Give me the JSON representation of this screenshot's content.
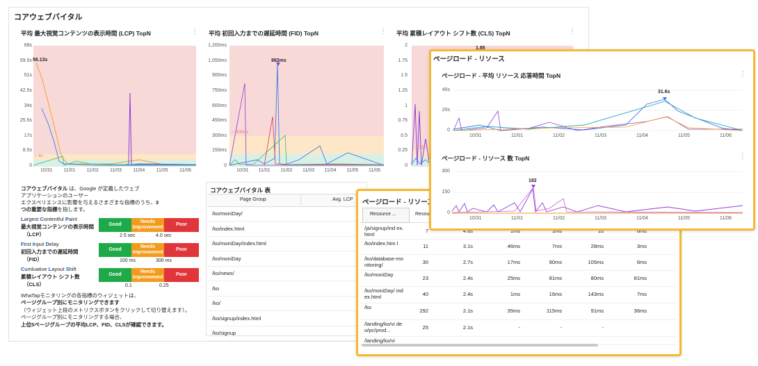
{
  "main": {
    "title": "コアウェブバイタル",
    "lcp": {
      "title": "平均 最大視覚コンテンツの表示時間 (LCP) TopN",
      "y_ticks": [
        "68s",
        "59.5s",
        "51s",
        "42.5s",
        "34s",
        "25.5s",
        "17s",
        "8.5s",
        "0"
      ],
      "x_ticks": [
        "10/31",
        "11/01",
        "11/02",
        "11/03",
        "11/04",
        "11/05",
        "11/06"
      ],
      "peak_label": "56.13s",
      "threshold_label": "~ 4s"
    },
    "fid": {
      "title": "平均 初回入力までの遅延時間 (FID) TopN",
      "y_ticks": [
        "1,200ms",
        "1,050ms",
        "900ms",
        "750ms",
        "600ms",
        "450ms",
        "300ms",
        "150ms",
        "0"
      ],
      "x_ticks": [
        "10/31",
        "11/01",
        "11/02",
        "11/03",
        "11/04",
        "11/05",
        "11/06"
      ],
      "peak_label": "982ms",
      "threshold_label": "~ 300ms"
    },
    "cls": {
      "title": "平均 累積レイアウト シフト数 (CLS) TopN",
      "y_ticks": [
        "2",
        "1.75",
        "1.5",
        "1.25",
        "1",
        "0.75",
        "0.5",
        "0.25",
        "0"
      ],
      "peak_label": "1.85",
      "threshold_label": "0.25"
    },
    "description": {
      "line1_bold": "コアウェブバイタル",
      "line1_rest": " は、Google が定義したウェブ",
      "line2": "アプリケーションのユーザー",
      "line3_a": "エクスペリエンスに影響を与えるさまざまな指標のうち、",
      "line3_b": "3",
      "line4": "つの重要な指標",
      "line4_rest": "を指します。"
    },
    "metrics": [
      {
        "en_first": "L",
        "en_rest1": "argest ",
        "en_c": "C",
        "en_rest2": "ontentful ",
        "en_p": "P",
        "en_rest3": "aint",
        "jp": "最大視覚コンテンツの表示時間",
        "abbr": "（LCP）",
        "good": "Good",
        "ni": "Needs Improvement",
        "poor": "Poor",
        "t1": "2.5 sec",
        "t2": "4.0 sec"
      },
      {
        "en_first": "F",
        "en_rest1": "irst ",
        "en_c": "I",
        "en_rest2": "nput ",
        "en_p": "D",
        "en_rest3": "elay",
        "jp": "初回入力までの遅延時間",
        "abbr": "（FID）",
        "good": "Good",
        "ni": "Needs Improvement",
        "poor": "Poor",
        "t1": "100 ms",
        "t2": "300 ms"
      },
      {
        "en_first": "C",
        "en_rest1": "umluative ",
        "en_c": "L",
        "en_rest2": "ayout ",
        "en_p": "S",
        "en_rest3": "hift",
        "jp": "累積レイアウト シフト数",
        "abbr": "（CLS）",
        "good": "Good",
        "ni": "Needs Improvement",
        "poor": "Poor",
        "t1": "0.1",
        "t2": "0.25"
      }
    ],
    "footnote": {
      "l1": "WhaTapモニタリングの各指標のウィジェットは、",
      "l2": "ページグループ別にモニタリングできます",
      "l3": "（ウィジェット上段のメトリクスボタンをクリックして切り替えます）。",
      "l4": "ページグループ別にモニタリングする場合、",
      "l5": "上位5ページグループの平均LCP、FID、CLSが確認できます。"
    },
    "table": {
      "title": "コアウェブバイタル 表",
      "headers": [
        "Page Group",
        "Avg. LCP"
      ],
      "rows": [
        "/ko/moniDay/",
        "/ko/index.html",
        "/ko/moniDay/index.html",
        "/ko/moniDay",
        "/ko/news/",
        "/ko",
        "/ko/",
        "/ko/signup/index.html",
        "/ko/signup"
      ]
    }
  },
  "resources_table": {
    "title": "ページロード - リソース",
    "headers": [
      "Resource ...",
      "Resou"
    ],
    "rows": [
      {
        "name": "/ja/signup/ind ex.html",
        "count": "7",
        "avg": "4.6s",
        "c3": "1ms",
        "c4": "1ms",
        "c5": "2s",
        "c6": "6ms"
      },
      {
        "name": "/ko/index.htm l",
        "count": "11",
        "avg": "3.1s",
        "c3": "46ms",
        "c4": "7ms",
        "c5": "28ms",
        "c6": "3ms"
      },
      {
        "name": "/ko/database-monitoring/",
        "count": "30",
        "avg": "2.7s",
        "c3": "17ms",
        "c4": "90ms",
        "c5": "105ms",
        "c6": "6ms"
      },
      {
        "name": "/ko/moniDay",
        "count": "23",
        "avg": "2.4s",
        "c3": "25ms",
        "c4": "81ms",
        "c5": "80ms",
        "c6": "81ms"
      },
      {
        "name": "/ko/moniDay/ index.html",
        "count": "40",
        "avg": "2.4s",
        "c3": "1ms",
        "c4": "16ms",
        "c5": "143ms",
        "c6": "7ms"
      },
      {
        "name": "/ko",
        "count": "292",
        "avg": "2.1s",
        "c3": "35ms",
        "c4": "115ms",
        "c5": "91ms",
        "c6": "36ms"
      },
      {
        "name": "/landing/ko/vi deo/pc/prod...",
        "count": "25",
        "avg": "2.1s",
        "c3": "-",
        "c4": "-",
        "c5": "-",
        "c6": ""
      },
      {
        "name": "/landing/ko/vi",
        "count": "",
        "avg": "",
        "c3": "",
        "c4": "",
        "c5": "",
        "c6": ""
      }
    ]
  },
  "resources_charts": {
    "title": "ページロード - リソース",
    "resp": {
      "title": "ページロード - 平均 リソース 応答時間 TopN",
      "y_ticks": [
        "40s",
        "20s",
        "0"
      ],
      "peak_label": "31.6s"
    },
    "count": {
      "title": "ページロード - リソース 数 TopN",
      "y_ticks": [
        "300",
        "150",
        "0"
      ],
      "peak_label": "182"
    },
    "x_ticks": [
      "10/31",
      "11/01",
      "11/02",
      "11/03",
      "11/04",
      "11/05",
      "11/06"
    ]
  },
  "icons": {
    "kebab": "⋮"
  },
  "colors": {
    "accent": "#f5b830",
    "good": "#1faa4a",
    "needs": "#f29b1d",
    "poor": "#e0353a"
  }
}
